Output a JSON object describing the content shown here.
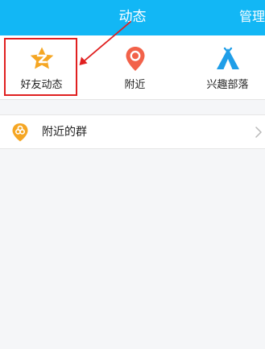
{
  "header": {
    "title": "动态",
    "manage_label": "管理",
    "bg_color": "#12b7f5"
  },
  "quick_items": [
    {
      "label": "好友动态",
      "icon": "friends-feed-star-icon",
      "color": "#f5a623"
    },
    {
      "label": "附近",
      "icon": "location-pin-icon",
      "color": "#f2624a"
    },
    {
      "label": "兴趣部落",
      "icon": "tribe-tent-icon",
      "color": "#1f9ee8"
    }
  ],
  "list": [
    {
      "label": "附近的群",
      "icon": "nearby-groups-icon",
      "color": "#f5a623"
    }
  ],
  "annotation": {
    "color": "#e02020"
  }
}
